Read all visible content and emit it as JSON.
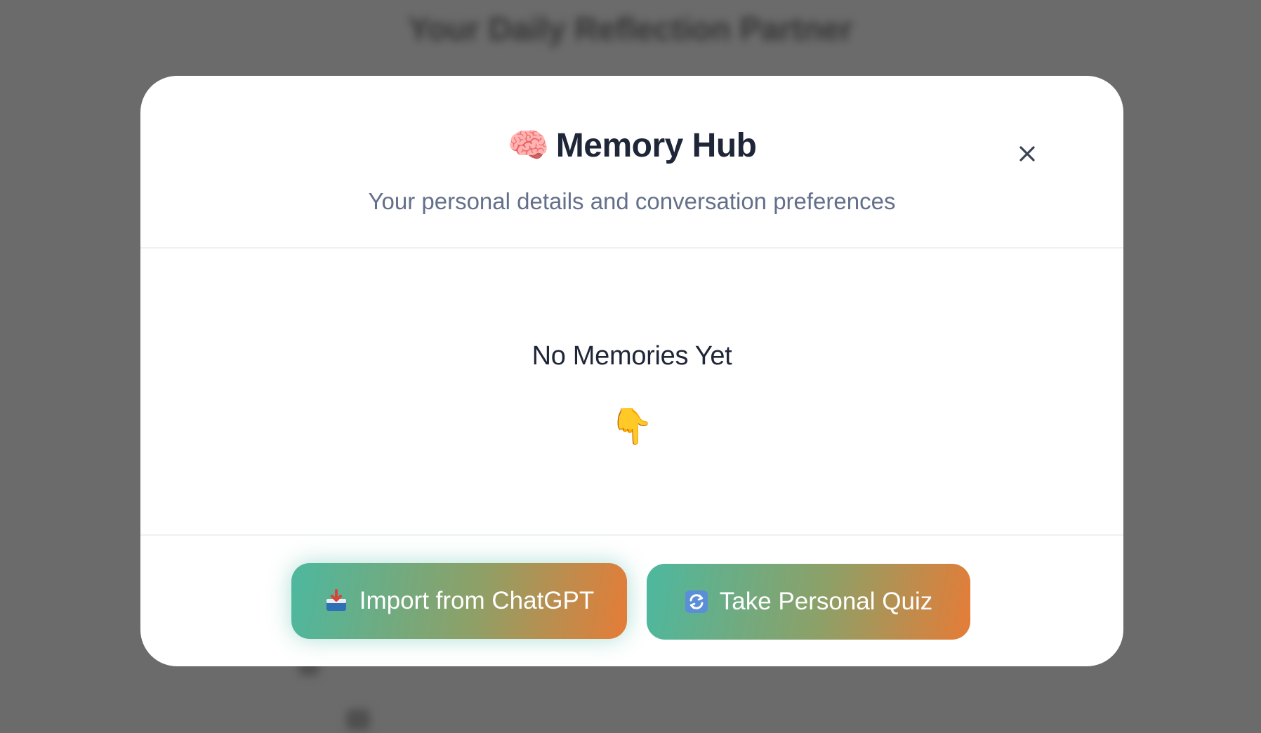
{
  "background": {
    "title": "Your Daily Reflection Partner"
  },
  "modal": {
    "title_emoji": "🧠",
    "title": "Memory Hub",
    "subtitle": "Your personal details and conversation preferences",
    "close_icon": "close-icon"
  },
  "empty_state": {
    "title": "No Memories Yet",
    "pointer_emoji": "👇"
  },
  "actions": {
    "import_label": "Import from ChatGPT",
    "import_icon": "inbox-tray-icon",
    "quiz_label": "Take Personal Quiz",
    "quiz_icon": "refresh-icon"
  },
  "colors": {
    "backdrop": "#6b6b6b",
    "title_text": "#1f2638",
    "subtitle_text": "#64708a",
    "button_gradient_start": "#4cb89f",
    "button_gradient_end": "#e57c37"
  }
}
